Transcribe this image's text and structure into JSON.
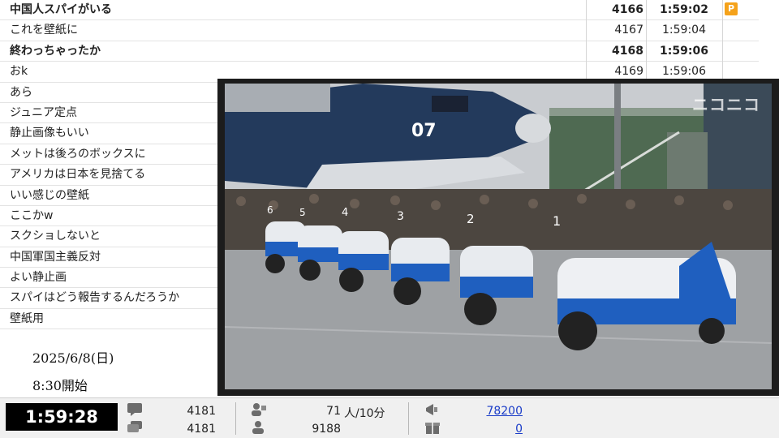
{
  "comments": [
    {
      "text": "中国人スパイがいる",
      "no": "4166",
      "time": "1:59:02",
      "bold": true,
      "premium": true
    },
    {
      "text": "これを壁紙に",
      "no": "4167",
      "time": "1:59:04",
      "bold": false,
      "premium": false
    },
    {
      "text": "終わっちゃったか",
      "no": "4168",
      "time": "1:59:06",
      "bold": true,
      "premium": false
    },
    {
      "text": "おk",
      "no": "4169",
      "time": "1:59:06",
      "bold": false,
      "premium": false
    },
    {
      "text": "あら",
      "no": "",
      "time": "",
      "bold": false,
      "premium": false
    },
    {
      "text": "ジュニア定点",
      "no": "",
      "time": "",
      "bold": false,
      "premium": false
    },
    {
      "text": "静止画像もいい",
      "no": "",
      "time": "",
      "bold": false,
      "premium": false
    },
    {
      "text": "メットは後ろのボックスに",
      "no": "",
      "time": "",
      "bold": false,
      "premium": false
    },
    {
      "text": "アメリカは日本を見捨てる",
      "no": "",
      "time": "",
      "bold": false,
      "premium": false
    },
    {
      "text": "いい感じの壁紙",
      "no": "",
      "time": "",
      "bold": false,
      "premium": false
    },
    {
      "text": "ここかw",
      "no": "",
      "time": "",
      "bold": false,
      "premium": false
    },
    {
      "text": "スクショしないと",
      "no": "",
      "time": "",
      "bold": false,
      "premium": false
    },
    {
      "text": "中国軍国主義反対",
      "no": "",
      "time": "",
      "bold": false,
      "premium": false
    },
    {
      "text": "よい静止画",
      "no": "",
      "time": "",
      "bold": false,
      "premium": false
    },
    {
      "text": "スパイはどう報告するんだろうか",
      "no": "",
      "time": "",
      "bold": false,
      "premium": false
    },
    {
      "text": "壁紙用",
      "no": "",
      "time": "",
      "bold": false,
      "premium": false
    }
  ],
  "premium_badge": "P",
  "info": {
    "date": "2025/6/8(日)",
    "start": "8:30開始"
  },
  "video": {
    "watermark": "ニコニコ",
    "aircraft_number": "07",
    "vehicle_numbers": [
      "6",
      "5",
      "4",
      "3",
      "2",
      "1"
    ]
  },
  "statusbar": {
    "elapsed": "1:59:28",
    "comments_total": "4181",
    "comments_total_2": "4181",
    "viewers_active": "71",
    "viewers_rate": "人/10分",
    "viewers_total": "9188",
    "ad_points": "78200",
    "gift_points": "0"
  },
  "colors": {
    "link": "#1a3cc8",
    "badge": "#f5a21a",
    "vehicle_blue": "#1f5fbf"
  }
}
